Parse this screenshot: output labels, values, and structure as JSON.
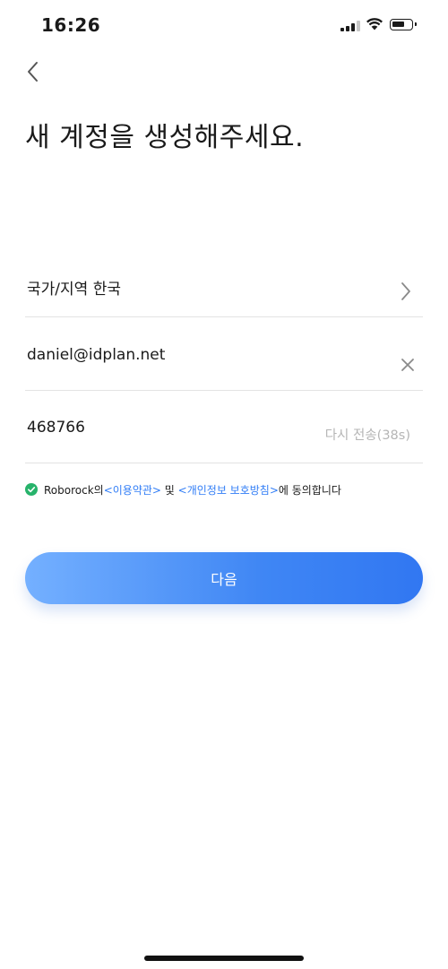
{
  "status_bar": {
    "time": "16:26"
  },
  "title": "새 계정을 생성해주세요.",
  "region": {
    "label": "국가/지역 한국"
  },
  "email": {
    "value": "daniel@idplan.net"
  },
  "code": {
    "value": "468766",
    "resend": "다시 전송(38s)"
  },
  "agreement": {
    "prefix": "Roborock의 ",
    "terms_link": "<이용약관>",
    "middle": " 및 ",
    "privacy_link": "<개인정보 보호방침>",
    "suffix": "에 동의합니다"
  },
  "next_button": {
    "label": "다음"
  },
  "colors": {
    "accent": "#3177f2",
    "check": "#27b36b",
    "link": "#2f7cf6"
  },
  "icons": [
    "back-chevron-icon",
    "chevron-right-icon",
    "clear-icon",
    "check-circle-icon",
    "signal-icon",
    "wifi-icon",
    "battery-icon"
  ]
}
